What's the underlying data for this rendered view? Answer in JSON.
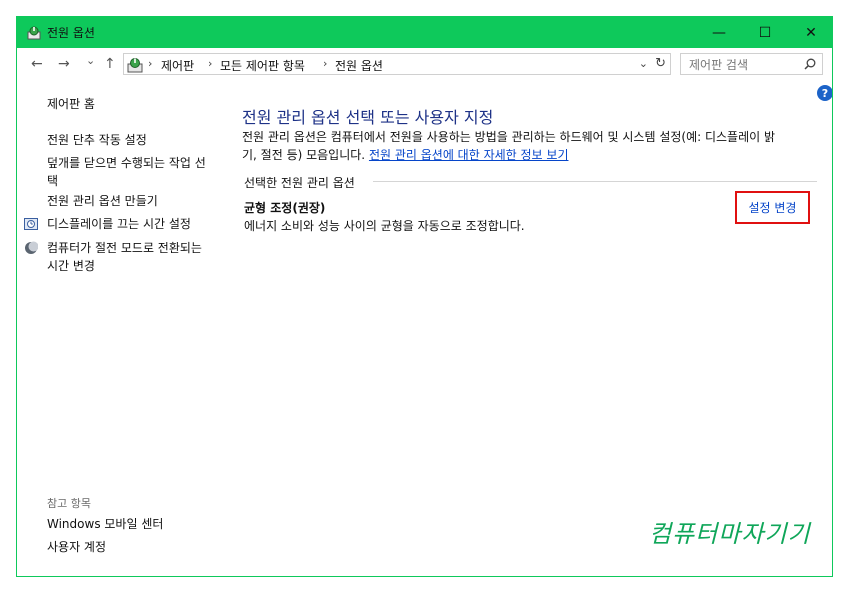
{
  "window": {
    "title": "전원 옵션",
    "accent_color": "#0ec95b",
    "controls": {
      "minimize": "—",
      "maximize": "☐",
      "close": "✕"
    }
  },
  "navbar": {
    "back": "←",
    "forward": "→",
    "recent": "⌄",
    "up": "↑",
    "breadcrumbs": [
      "제어판",
      "모든 제어판 항목",
      "전원 옵션"
    ],
    "breadcrumb_separator": "›",
    "dropdown": "⌄",
    "refresh": "↻",
    "search_placeholder": "제어판 검색"
  },
  "help": {
    "label": "?"
  },
  "sidebar": {
    "home": "제어판 홈",
    "links": [
      "전원 단추 작동 설정",
      "덮개를 닫으면 수행되는 작업 선택",
      "전원 관리 옵션 만들기",
      "디스플레이를 끄는 시간 설정",
      "컴퓨터가 절전 모드로 전환되는 시간 변경"
    ],
    "see_also": {
      "heading": "참고 항목",
      "links": [
        "Windows 모바일 센터",
        "사용자 계정"
      ]
    }
  },
  "main": {
    "title": "전원 관리 옵션 선택 또는 사용자 지정",
    "description_line1": "전원 관리 옵션은 컴퓨터에서 전원을 사용하는 방법을 관리하는 하드웨어 및 시스템 설정(예: 디스플레이 밝",
    "description_line2": "기, 절전 등) 모음입니다.",
    "description_link": "전원 관리 옵션에 대한 자세한 정보 보기",
    "section_label": "선택한 전원 관리 옵션",
    "plan": {
      "name": "균형 조정(권장)",
      "description": "에너지 소비와 성능 사이의 균형을 자동으로 조정합니다.",
      "change_settings": "설정 변경"
    }
  },
  "watermark": "컴퓨터마자기기",
  "colors": {
    "link": "#0645c9",
    "title": "#1e3287",
    "highlight": "#e01010"
  }
}
